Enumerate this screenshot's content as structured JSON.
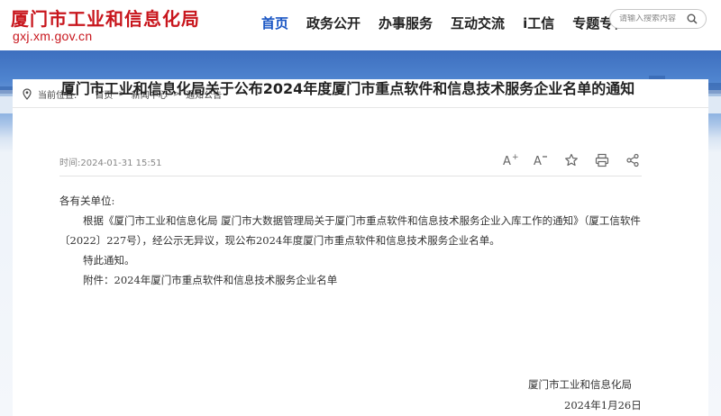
{
  "header": {
    "site_title": "厦门市工业和信息化局",
    "site_domain": "gxj.xm.gov.cn",
    "nav": [
      "首页",
      "政务公开",
      "办事服务",
      "互动交流",
      "i工信",
      "专题专栏"
    ],
    "active_nav": "首页",
    "search_placeholder": "请输入搜索内容"
  },
  "breadcrumb": {
    "label": "当前位置:",
    "items": [
      "首页",
      "新闻中心",
      "通知公告"
    ],
    "separator": ">"
  },
  "article": {
    "title": "厦门市工业和信息化局关于公布2024年度厦门市重点软件和信息技术服务企业名单的通知",
    "publish_time": "时间:2024-01-31 15:51",
    "tools": [
      "font-increase-icon",
      "font-decrease-icon",
      "favorite-icon",
      "print-icon",
      "share-icon"
    ],
    "salutation": "各有关单位:",
    "paragraph1": "根据《厦门市工业和信息化局 厦门市大数据管理局关于厦门市重点软件和信息技术服务企业入库工作的通知》（厦工信软件〔2022〕227号），经公示无异议，现公布2024年度厦门市重点软件和信息技术服务企业名单。",
    "paragraph2": "特此通知。",
    "attachment": "附件：2024年厦门市重点软件和信息技术服务企业名单",
    "sign_org": "厦门市工业和信息化局",
    "sign_date": "2024年1月26日"
  },
  "colors": {
    "brand_red": "#c8161d",
    "nav_active": "#1a56c4",
    "title_text": "#222222"
  }
}
